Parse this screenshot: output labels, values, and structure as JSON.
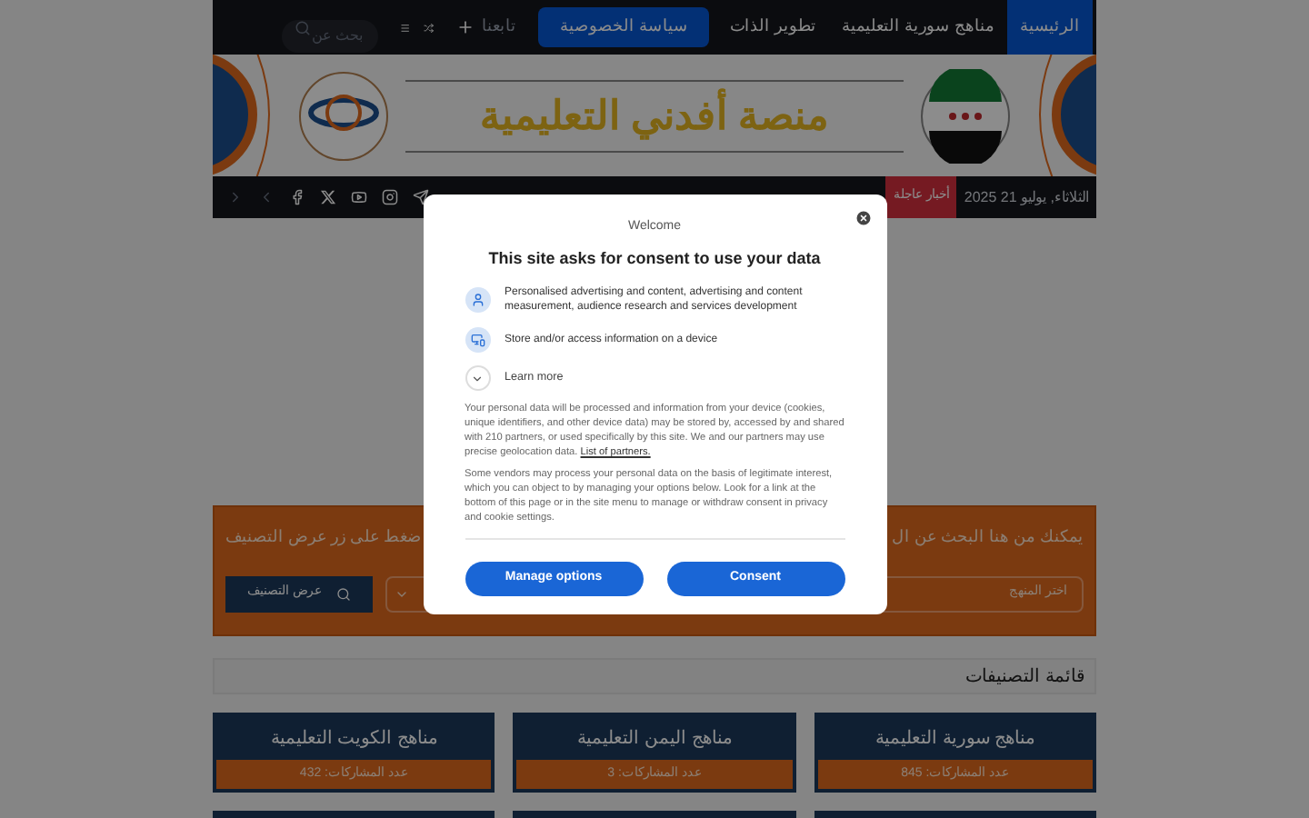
{
  "nav": {
    "items": [
      {
        "label": "الرئيسية",
        "selected": true,
        "kind": "link"
      },
      {
        "label": "مناهج سورية التعليمية",
        "selected": false,
        "kind": "link"
      },
      {
        "label": "تطوير الذات",
        "selected": false,
        "kind": "link"
      },
      {
        "label": "سياسة الخصوصية",
        "selected": false,
        "kind": "button"
      }
    ],
    "follow": "تابعنا",
    "search": {
      "placeholder": "بحث عن"
    }
  },
  "banner": {
    "title": "منصة أفدني التعليمية"
  },
  "ticker": {
    "date": "الثلاثاء, يوليو 21 2025",
    "badge": "أخبار عاجلة"
  },
  "finder": {
    "text_right": "يمكنك من هنا البحث عن ال",
    "text_left": "ضغط على زر عرض التصنيف",
    "select_placeholder": "اختر المنهج",
    "button": "عرض التصنيف"
  },
  "categories": {
    "heading": "قائمة التصنيفات",
    "cards": [
      {
        "title": "مناهج سورية التعليمية",
        "count": "عدد المشاركات: 845"
      },
      {
        "title": "مناهج اليمن التعليمية",
        "count": "عدد المشاركات: 3"
      },
      {
        "title": "مناهج الكويت التعليمية",
        "count": "عدد المشاركات: 432"
      }
    ]
  },
  "consent": {
    "heading": "Welcome",
    "title": "This site asks for consent to use your data",
    "purposes": [
      {
        "kind": "person",
        "text": "Personalised advertising and content, advertising and content measurement, audience research and services development"
      },
      {
        "kind": "device",
        "text": "Store and/or access information on a device"
      }
    ],
    "learn_more": "Learn more",
    "paragraph_1": "Your personal data will be processed and information from your device (cookies, unique identifiers, and other device data) may be stored by, accessed by and shared with 210 partners, or used specifically by this site. We and our partners may use precise geolocation data.",
    "partners_link": "List of partners.",
    "paragraph_2": "Some vendors may process your personal data on the basis of legitimate interest, which you can object to by managing your options below. Look for a link at the bottom of this page or in the site menu to manage or withdraw consent in privacy and cookie settings.",
    "manage_button": "Manage options",
    "consent_button": "Consent"
  }
}
